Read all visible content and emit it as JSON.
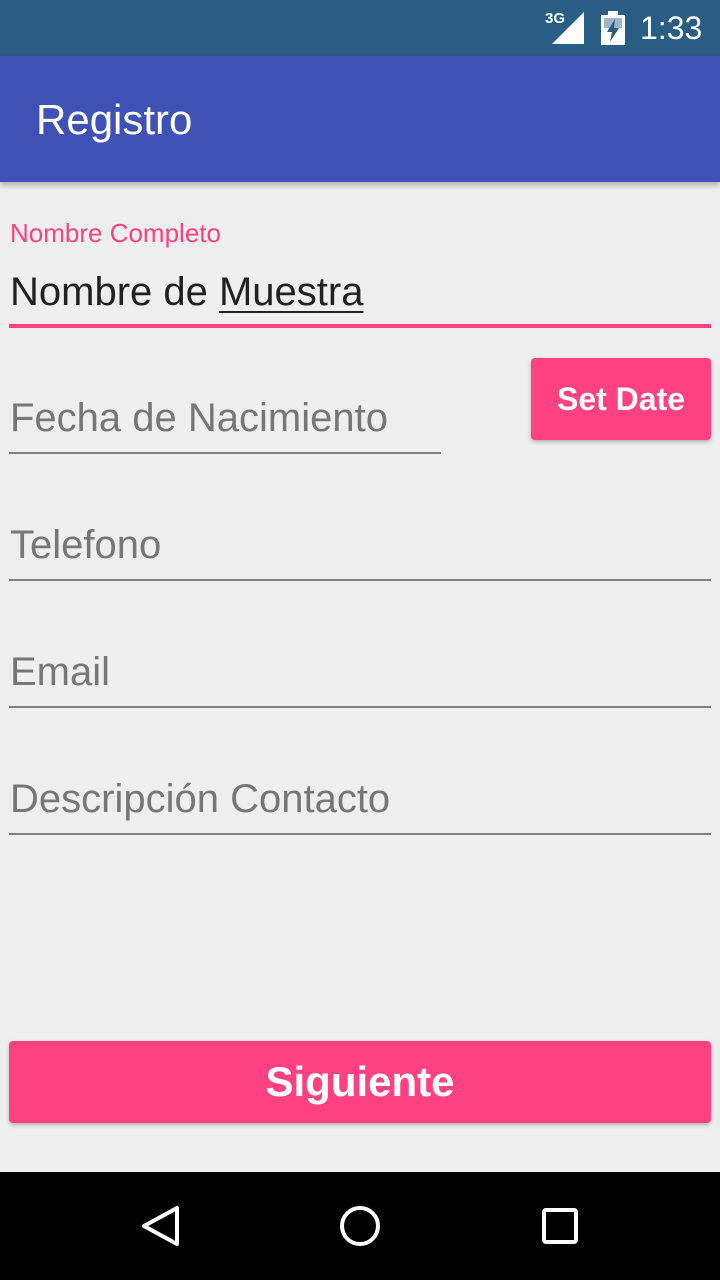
{
  "status_bar": {
    "network": "3G",
    "time": "1:33",
    "icons": [
      "signal-icon",
      "battery-charging-icon"
    ]
  },
  "app_bar": {
    "title": "Registro",
    "color": "#3f51b5"
  },
  "form": {
    "nombre": {
      "label": "Nombre Completo",
      "value_plain": "Nombre de ",
      "value_composing": "Muestra"
    },
    "fecha": {
      "placeholder": "Fecha de Nacimiento",
      "button_label": "Set Date"
    },
    "telefono": {
      "placeholder": "Telefono"
    },
    "email": {
      "placeholder": "Email"
    },
    "descripcion": {
      "placeholder": "Descripción Contacto"
    },
    "next_label": "Siguiente"
  },
  "navigation": {
    "icons": [
      "back-icon",
      "home-icon",
      "recents-icon"
    ]
  },
  "colors": {
    "accent": "#ff4081",
    "primary": "#3f51b5",
    "status_bar": "#2a5d84"
  }
}
